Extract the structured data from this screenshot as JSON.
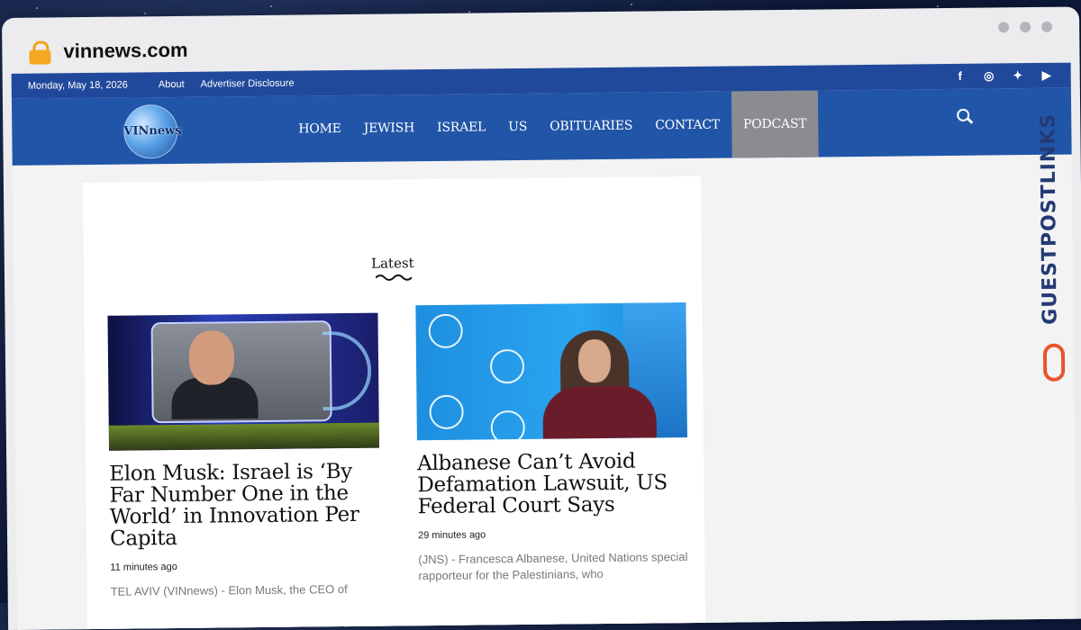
{
  "browser": {
    "url": "vinnews.com"
  },
  "topbar": {
    "date": "Monday, May 18, 2026",
    "links": [
      "About",
      "Advertiser Disclosure"
    ],
    "social_icons": [
      "facebook-icon",
      "instagram-icon",
      "twitter-icon",
      "youtube-icon"
    ]
  },
  "nav": {
    "logo_text": "VINnews",
    "items": [
      "HOME",
      "JEWISH",
      "ISRAEL",
      "US",
      "OBITUARIES",
      "CONTACT",
      "PODCAST"
    ],
    "active": "PODCAST"
  },
  "section": {
    "heading": "Latest"
  },
  "articles": [
    {
      "title": "Elon Musk: Israel is ‘By Far Number One in the World’ in Innovation Per Capita",
      "time": "11 minutes ago",
      "excerpt": "TEL AVIV (VINnews) - Elon Musk, the CEO of"
    },
    {
      "title": "Albanese Can’t Avoid Defamation Lawsuit, US Federal Court Says",
      "time": "29 minutes ago",
      "excerpt": "(JNS) - Francesca Albanese, United Nations special rapporteur for the Palestinians, who"
    }
  ],
  "watermark": "GUESTPOSTLINKS",
  "colors": {
    "topbar": "#21499b",
    "navbar": "#2155a8",
    "active_tab": "#8a8c90",
    "brand_orange": "#e8552b"
  }
}
